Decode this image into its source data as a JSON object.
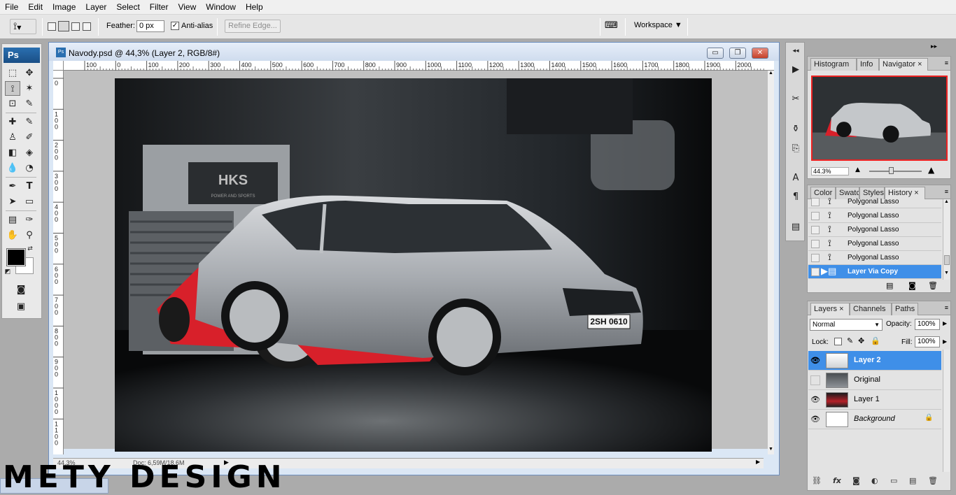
{
  "menu": [
    "File",
    "Edit",
    "Image",
    "Layer",
    "Select",
    "Filter",
    "View",
    "Window",
    "Help"
  ],
  "options": {
    "feather_label": "Feather:",
    "feather_value": "0 px",
    "antialias_label": "Anti-alias",
    "antialias_checked": "✓",
    "refine_edge_label": "Refine Edge...",
    "workspace_label": "Workspace ▼"
  },
  "tools": {
    "logo": "Ps"
  },
  "document": {
    "title": "Navody.psd @ 44,3% (Layer 2, RGB/8#)",
    "minimize": "▭",
    "restore": "❐",
    "close": "✕",
    "ruler_h": [
      "100",
      "0",
      "100",
      "200",
      "300",
      "400",
      "500",
      "600",
      "700",
      "800",
      "900",
      "1000",
      "1100",
      "1200",
      "1300",
      "1400",
      "1500",
      "1600",
      "1700",
      "1800",
      "1900",
      "2000"
    ],
    "ruler_v": [
      "0",
      "1 0 0",
      "2 0 0",
      "3 0 0",
      "4 0 0",
      "5 0 0",
      "6 0 0",
      "7 0 0",
      "8 0 0",
      "9 0 0",
      "1 0 0 0",
      "1 1 0 0"
    ],
    "status_zoom": "44,3%",
    "status_doc": "Doc: 6,59M/18,6M",
    "photo_sign": "HKS",
    "photo_sign_sub": "POWER AND SPORTS",
    "plate": "2SH 0610"
  },
  "navigator_panel": {
    "tabs": [
      "Histogram",
      "Info",
      "Navigator ×"
    ],
    "zoom": "44.3%"
  },
  "history_panel": {
    "tabs": [
      "Color",
      "Swatc",
      "Styles",
      "History ×"
    ],
    "items": [
      "Polygonal Lasso",
      "Polygonal Lasso",
      "Polygonal Lasso",
      "Polygonal Lasso",
      "Polygonal Lasso",
      "Layer Via Copy"
    ]
  },
  "layers_panel": {
    "tabs": [
      "Layers ×",
      "Channels",
      "Paths"
    ],
    "blend_mode": "Normal",
    "opacity_label": "Opacity:",
    "opacity_value": "100%",
    "lock_label": "Lock:",
    "fill_label": "Fill:",
    "fill_value": "100%",
    "layers": [
      "Layer 2",
      "Original",
      "Layer 1",
      "Background"
    ]
  },
  "watermark": "METY DESIGN",
  "colors": {
    "selection": "#3f8fe8",
    "accent_red": "#e02020"
  }
}
